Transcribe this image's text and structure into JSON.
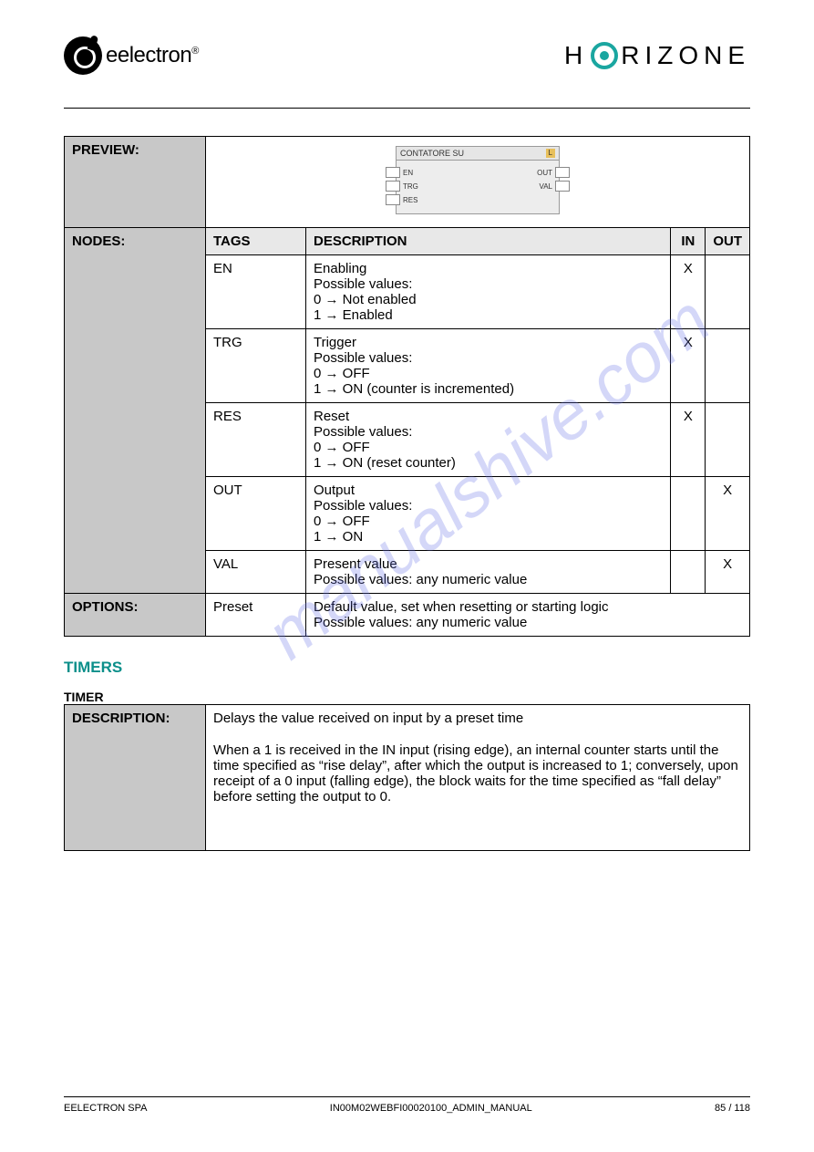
{
  "header": {
    "left_logo_text": "eelectron",
    "left_logo_reg": "®",
    "right_logo_pre": "H",
    "right_logo_post": "RIZONE"
  },
  "watermark": "manualshive.com",
  "table1": {
    "preview_label": "PREVIEW:",
    "preview_diagram": {
      "title": "CONTATORE SU",
      "badge": "L",
      "left_ports": [
        "EN",
        "TRG",
        "RES"
      ],
      "right_ports": [
        "OUT",
        "VAL"
      ]
    },
    "nodes_label": "NODES:",
    "headers": {
      "tags": "TAGS",
      "desc": "DESCRIPTION",
      "in": "IN",
      "out": "OUT"
    },
    "rows": [
      {
        "tag": "EN",
        "desc": "Enabling\nPossible values:\n0 → Not enabled\n1 → Enabled",
        "in": "X",
        "out": ""
      },
      {
        "tag": "TRG",
        "desc": "Trigger\nPossible values:\n0 → OFF\n1 → ON (counter is incremented)",
        "in": "X",
        "out": ""
      },
      {
        "tag": "RES",
        "desc": "Reset\nPossible values:\n0 → OFF\n1 → ON (reset counter)",
        "in": "X",
        "out": ""
      },
      {
        "tag": "OUT",
        "desc": "Output\nPossible values:\n0 → OFF\n1 → ON",
        "in": "",
        "out": "X"
      },
      {
        "tag": "VAL",
        "desc": "Present value\nPossible values: any numeric value",
        "in": "",
        "out": "X"
      }
    ],
    "options_label": "OPTIONS:",
    "options_tag": "Preset",
    "options_desc": "Default value, set when resetting or starting logic\nPossible values: any numeric value"
  },
  "section_heading": "TIMERS",
  "subsection_heading": "TIMER",
  "table2": {
    "label": "DESCRIPTION:",
    "intro": "Delays the value received on input by a preset time",
    "body": "When a 1 is received in the IN input (rising edge), an internal counter starts until the time specified as “rise delay”, after which the output is increased to 1; conversely, upon receipt of a 0 input (falling edge), the block waits for the time specified as “fall delay” before setting the output to 0."
  },
  "footer": {
    "left": "EELECTRON SPA",
    "center": "IN00M02WEBFI00020100_ADMIN_MANUAL",
    "right": "85 / 118"
  }
}
